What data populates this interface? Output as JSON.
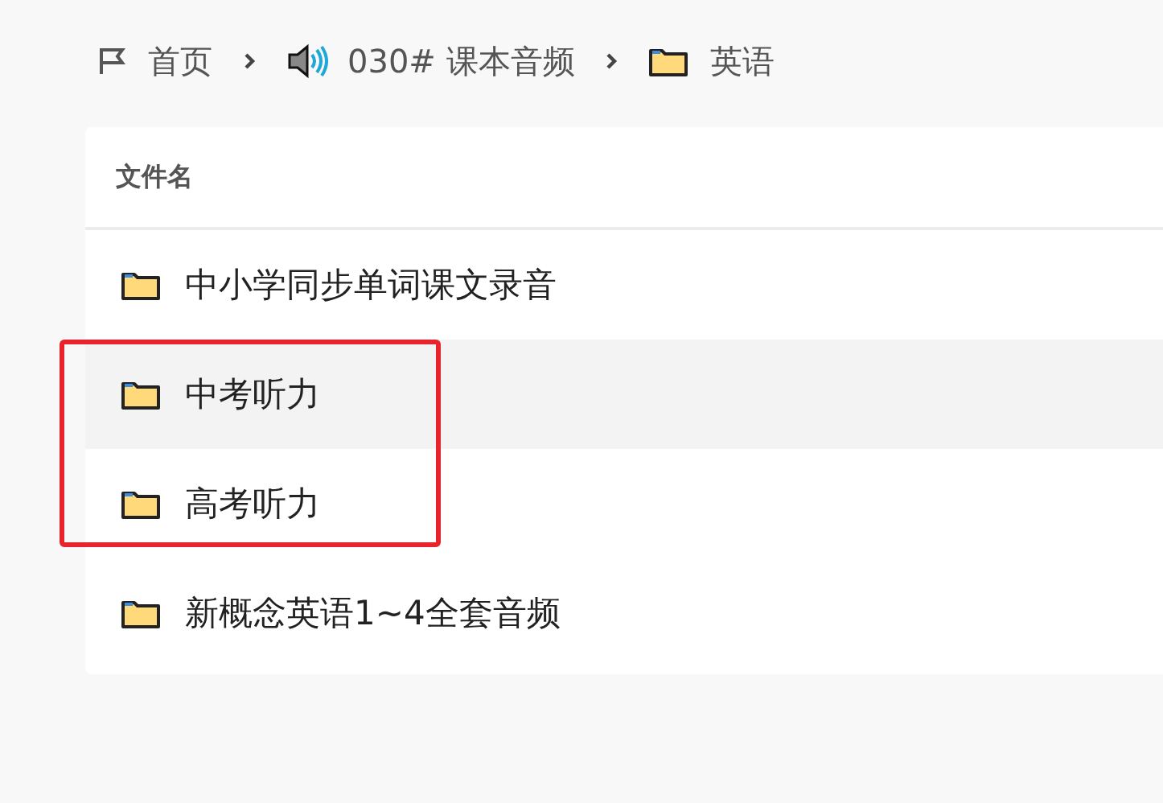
{
  "breadcrumb": [
    {
      "kind": "home",
      "label": "首页"
    },
    {
      "kind": "audio",
      "label": "030# 课本音频"
    },
    {
      "kind": "folder",
      "label": "英语"
    }
  ],
  "table": {
    "columns": [
      "文件名"
    ],
    "rows": [
      {
        "name": "中小学同步单词课文录音",
        "hovered": false,
        "marked": false
      },
      {
        "name": "中考听力",
        "hovered": true,
        "marked": true
      },
      {
        "name": "高考听力",
        "hovered": false,
        "marked": true
      },
      {
        "name": "新概念英语1~4全套音频",
        "hovered": false,
        "marked": false
      }
    ]
  }
}
